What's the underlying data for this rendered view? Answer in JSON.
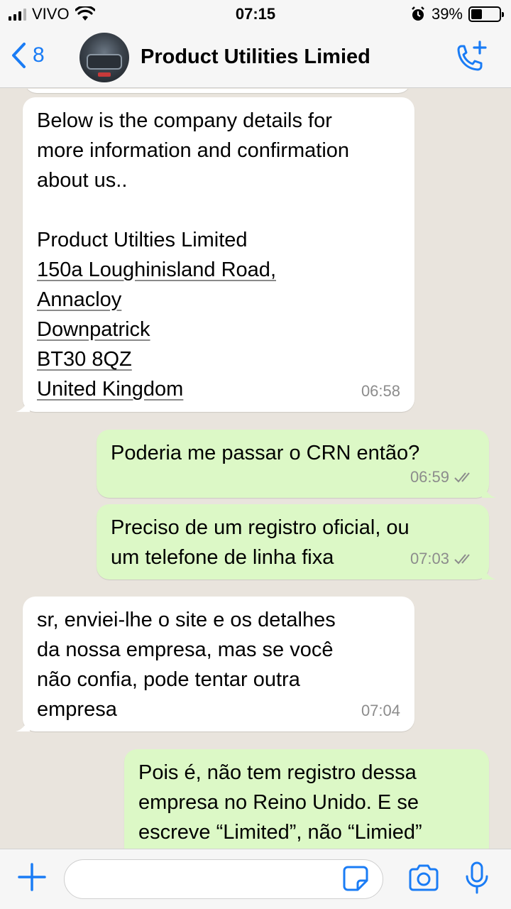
{
  "status_bar": {
    "carrier": "VIVO",
    "time": "07:15",
    "battery": "39%",
    "battery_level": 0.39,
    "icons": [
      "signal-icon",
      "wifi-icon",
      "alarm-icon",
      "battery-icon"
    ]
  },
  "header": {
    "back_count": "8",
    "contact_name": "Product Utilities Limied"
  },
  "messages": [
    {
      "direction": "in",
      "lines": [
        "Below is the company details for",
        "more information and confirmation",
        "about us..",
        "",
        "Product Utilties Limited"
      ],
      "address": [
        "150a Loughinisland Road,",
        "Annacloy",
        "Downpatrick",
        "BT30 8QZ",
        "United Kingdom"
      ],
      "time": "06:58"
    },
    {
      "direction": "out",
      "text": "Poderia me passar o CRN então?",
      "time": "06:59",
      "status": "read"
    },
    {
      "direction": "out",
      "text": "Preciso de um registro oficial, ou\num telefone de linha fixa",
      "time": "07:03",
      "status": "read"
    },
    {
      "direction": "in",
      "text": "sr, enviei-lhe o site e os detalhes\nda nossa empresa, mas se você\nnão confia, pode tentar outra\nempresa",
      "time": "07:04"
    },
    {
      "direction": "out",
      "text": "Pois é, não tem registro dessa\nempresa no Reino Unido. E se\nescreve “Limited”, não “Limied”"
    }
  ],
  "input": {
    "placeholder": "",
    "value": ""
  },
  "colors": {
    "accent": "#1a7cf5",
    "incoming_bubble": "#ffffff",
    "outgoing_bubble": "#dcf8c6",
    "chat_background": "#e9e4dd",
    "read_ticks": "#8c8c8c"
  }
}
